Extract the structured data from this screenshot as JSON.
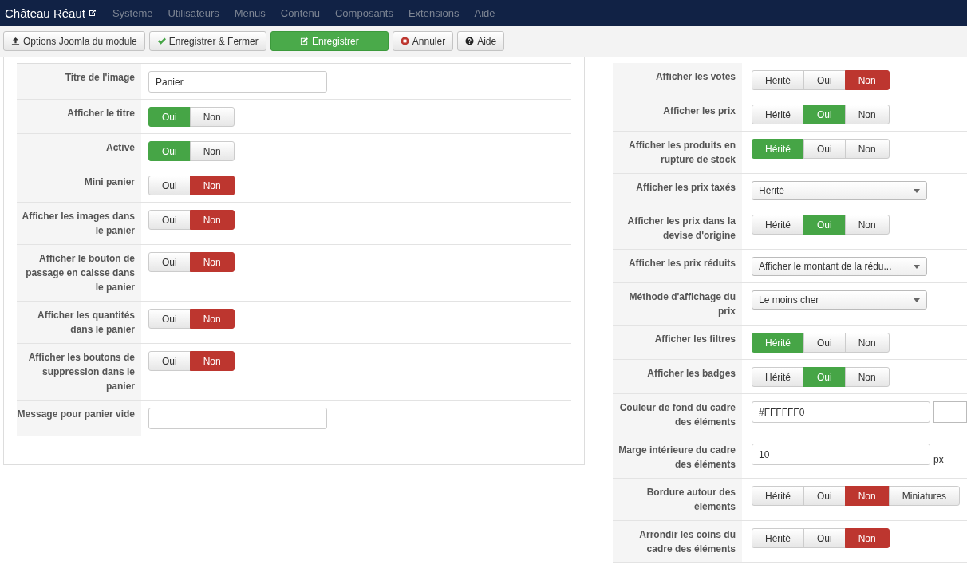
{
  "navbar": {
    "site_title": "Château Réaut",
    "menu": [
      {
        "label": "Système"
      },
      {
        "label": "Utilisateurs"
      },
      {
        "label": "Menus"
      },
      {
        "label": "Contenu"
      },
      {
        "label": "Composants"
      },
      {
        "label": "Extensions"
      },
      {
        "label": "Aide"
      }
    ]
  },
  "toolbar": [
    {
      "label": "Options Joomla du module",
      "kind": "options"
    },
    {
      "label": "Enregistrer & Fermer",
      "kind": "save-close"
    },
    {
      "label": "Enregistrer",
      "kind": "save"
    },
    {
      "label": "Annuler",
      "kind": "cancel"
    },
    {
      "label": "Aide",
      "kind": "help"
    }
  ],
  "left_fields": [
    {
      "label": "Titre de l'image",
      "kind": "text",
      "value": "Panier"
    },
    {
      "label": "Afficher le titre",
      "kind": "toggle",
      "options": [
        {
          "label": "Oui",
          "selected": true,
          "color": "#46a546"
        },
        {
          "label": "Non",
          "selected": false
        }
      ]
    },
    {
      "label": "Activé",
      "kind": "toggle",
      "options": [
        {
          "label": "Oui",
          "selected": true,
          "color": "#46a546"
        },
        {
          "label": "Non",
          "selected": false
        }
      ]
    },
    {
      "label": "Mini panier",
      "kind": "toggle",
      "options": [
        {
          "label": "Oui",
          "selected": false
        },
        {
          "label": "Non",
          "selected": true,
          "color": "#bd362f"
        }
      ]
    },
    {
      "label": "Afficher les images dans le panier",
      "kind": "toggle",
      "options": [
        {
          "label": "Oui",
          "selected": false
        },
        {
          "label": "Non",
          "selected": true,
          "color": "#bd362f"
        }
      ]
    },
    {
      "label": "Afficher le bouton de passage en caisse dans le panier",
      "kind": "toggle",
      "options": [
        {
          "label": "Oui",
          "selected": false
        },
        {
          "label": "Non",
          "selected": true,
          "color": "#bd362f"
        }
      ]
    },
    {
      "label": "Afficher les quantités dans le panier",
      "kind": "toggle",
      "options": [
        {
          "label": "Oui",
          "selected": false
        },
        {
          "label": "Non",
          "selected": true,
          "color": "#bd362f"
        }
      ]
    },
    {
      "label": "Afficher les boutons de suppression dans le panier",
      "kind": "toggle",
      "options": [
        {
          "label": "Oui",
          "selected": false
        },
        {
          "label": "Non",
          "selected": true,
          "color": "#bd362f"
        }
      ]
    },
    {
      "label": "Message pour panier vide",
      "kind": "text"
    }
  ],
  "right_fields": [
    {
      "label": "Afficher les votes",
      "kind": "toggle",
      "options": [
        {
          "label": "Hérité",
          "selected": false
        },
        {
          "label": "Oui",
          "selected": false
        },
        {
          "label": "Non",
          "selected": true,
          "color": "#bd362f"
        }
      ]
    },
    {
      "label": "Afficher les prix",
      "kind": "toggle",
      "options": [
        {
          "label": "Hérité",
          "selected": false
        },
        {
          "label": "Oui",
          "selected": true,
          "color": "#46a546"
        },
        {
          "label": "Non",
          "selected": false
        }
      ]
    },
    {
      "label": "Afficher les produits en rupture de stock",
      "kind": "toggle",
      "options": [
        {
          "label": "Hérité",
          "selected": true,
          "color": "#46a546"
        },
        {
          "label": "Oui",
          "selected": false
        },
        {
          "label": "Non",
          "selected": false
        }
      ]
    },
    {
      "label": "Afficher les prix taxés",
      "kind": "select",
      "value": "Hérité"
    },
    {
      "label": "Afficher les prix dans la devise d'origine",
      "kind": "toggle",
      "options": [
        {
          "label": "Hérité",
          "selected": false
        },
        {
          "label": "Oui",
          "selected": true,
          "color": "#46a546"
        },
        {
          "label": "Non",
          "selected": false
        }
      ]
    },
    {
      "label": "Afficher les prix réduits",
      "kind": "select",
      "value": "Afficher le montant de la rédu..."
    },
    {
      "label": "Méthode d'affichage du prix",
      "kind": "select",
      "value": "Le moins cher"
    },
    {
      "label": "Afficher les filtres",
      "kind": "toggle",
      "options": [
        {
          "label": "Hérité",
          "selected": true,
          "color": "#46a546"
        },
        {
          "label": "Oui",
          "selected": false
        },
        {
          "label": "Non",
          "selected": false
        }
      ]
    },
    {
      "label": "Afficher les badges",
      "kind": "toggle",
      "options": [
        {
          "label": "Hérité",
          "selected": false
        },
        {
          "label": "Oui",
          "selected": true,
          "color": "#46a546"
        },
        {
          "label": "Non",
          "selected": false
        }
      ]
    },
    {
      "label": "Couleur de fond du cadre des éléments",
      "kind": "color",
      "value": "#FFFFFF0"
    },
    {
      "label": "Marge intérieure du cadre des éléments",
      "kind": "number",
      "value": "10",
      "unit": "px"
    },
    {
      "label": "Bordure autour des éléments",
      "kind": "toggle",
      "options": [
        {
          "label": "Hérité",
          "selected": false
        },
        {
          "label": "Oui",
          "selected": false
        },
        {
          "label": "Non",
          "selected": true,
          "color": "#bd362f"
        },
        {
          "label": "Miniatures",
          "selected": false
        }
      ]
    },
    {
      "label": "Arrondir les coins du cadre des éléments",
      "kind": "toggle",
      "options": [
        {
          "label": "Hérité",
          "selected": false
        },
        {
          "label": "Oui",
          "selected": false
        },
        {
          "label": "Non",
          "selected": true,
          "color": "#bd362f"
        }
      ]
    }
  ]
}
